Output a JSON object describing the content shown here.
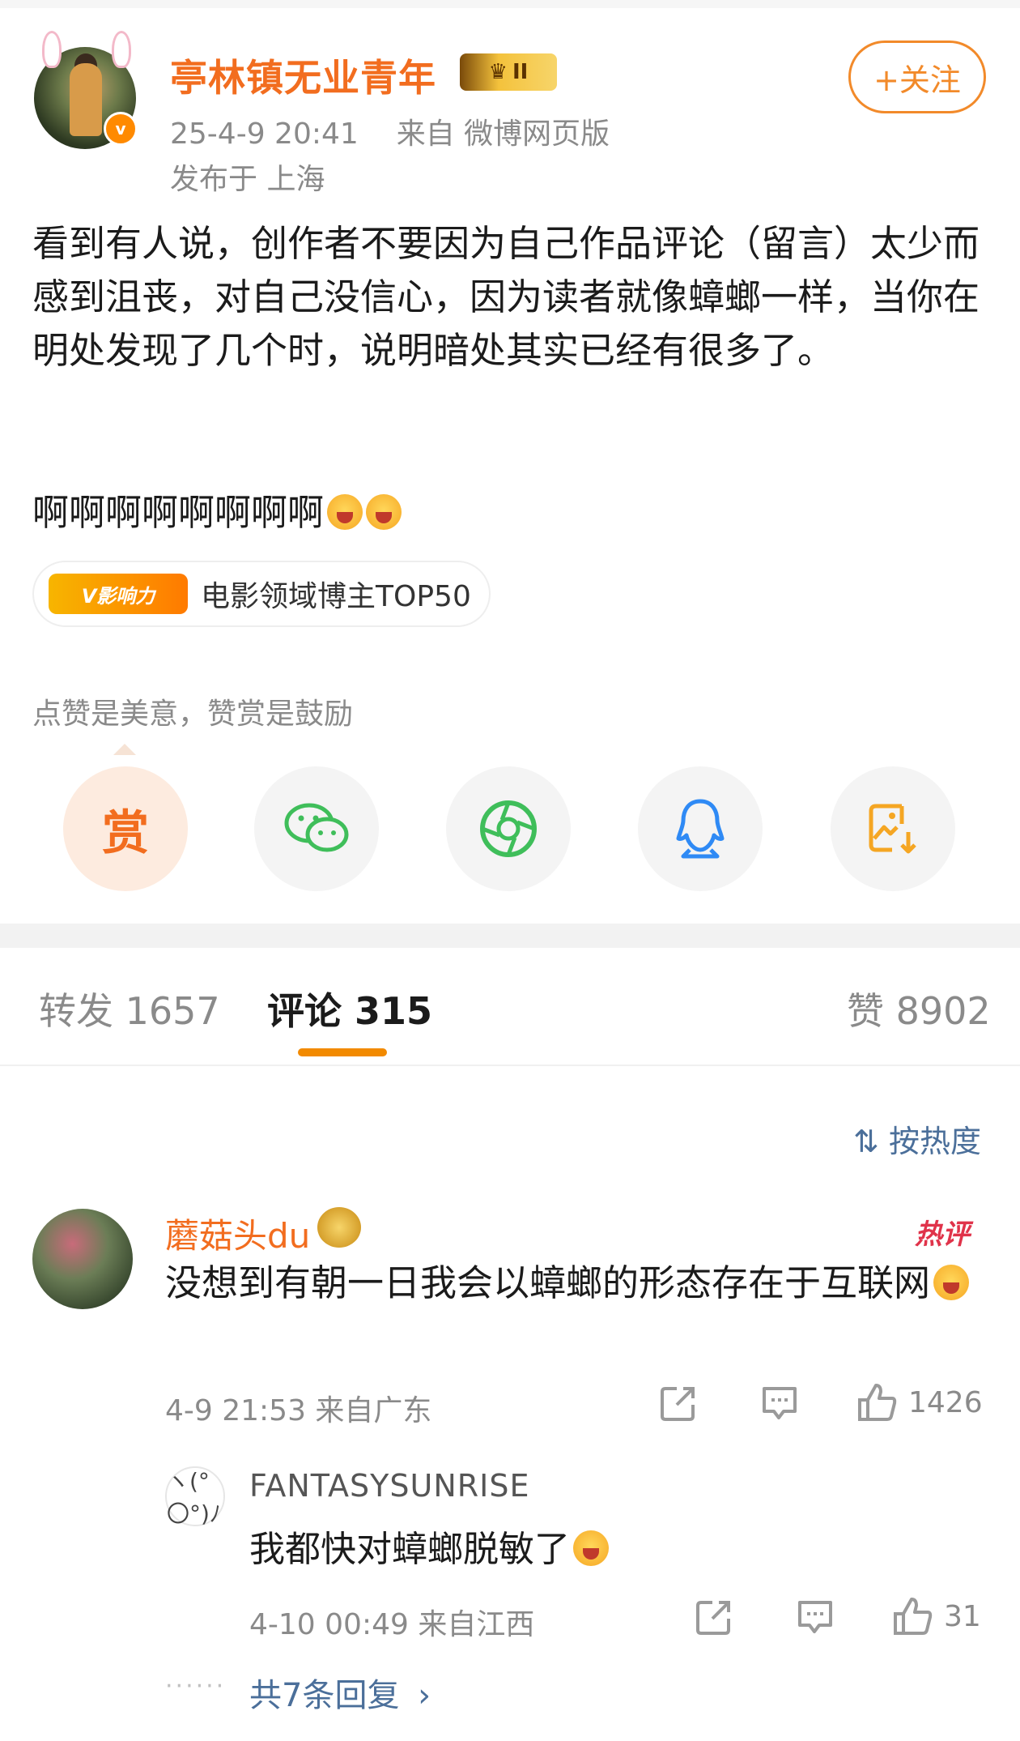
{
  "post": {
    "author": "亭林镇无业青年",
    "level_badge": "II",
    "time": "25-4-9 20:41",
    "source": "来自 微博网页版",
    "location": "发布于 上海",
    "follow_label": "+关注",
    "text": "看到有人说，创作者不要因为自己作品评论（留言）太少而感到沮丧，对自己没信心，因为读者就像蟑螂一样，当你在明处发现了几个时，说明暗处其实已经有很多了。",
    "text2": "啊啊啊啊啊啊啊啊",
    "influence_badge": "V影响力",
    "influence_text": "电影领域博主TOP50",
    "reward_tip": "点赞是美意，赞赏是鼓励",
    "reward_label": "赏"
  },
  "share": {
    "items": [
      "reward",
      "wechat-icon",
      "moments-icon",
      "qq-icon",
      "save-image-icon"
    ]
  },
  "tabs": {
    "repost": "转发 1657",
    "comment": "评论 315",
    "like": "赞 8902"
  },
  "sort_label": "按热度",
  "comments": [
    {
      "name": "蘑菇头du",
      "hot_label": "热评",
      "text": "没想到有朝一日我会以蟑螂的形态存在于互联网",
      "meta": "4-9 21:53 来自广东",
      "likes": "1426",
      "reply": {
        "name": "FANTASYSUNRISE",
        "text": "我都快对蟑螂脱敏了",
        "meta": "4-10 00:49 来自江西",
        "likes": "31"
      },
      "more_replies": "共7条回复"
    }
  ],
  "colors": {
    "brand_orange": "#f26d1f",
    "link_blue": "#4b6f9a",
    "hot_red": "#e0334a",
    "tab_underline": "#f28a00"
  }
}
